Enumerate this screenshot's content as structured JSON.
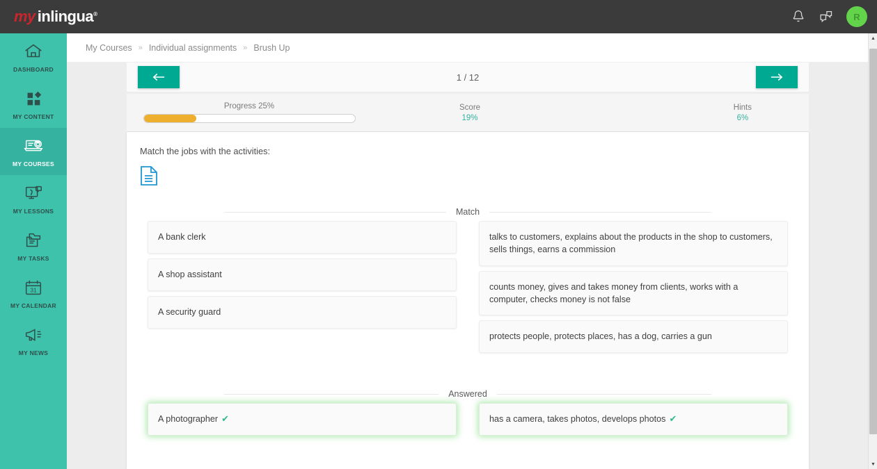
{
  "topbar": {
    "logo_my": "my",
    "logo_name": "inlingua",
    "logo_reg": "®",
    "bell_icon": "bell-icon",
    "chat_icon": "chat-bubbles-icon",
    "avatar_initial": "R",
    "avatar_color": "#62d34a",
    "background": "#3b3b3b"
  },
  "sidebar": {
    "background": "#3ec2ac",
    "active_background": "#35b2a0",
    "items": [
      {
        "label": "DASHBOARD",
        "icon": "home-icon",
        "active": false
      },
      {
        "label": "MY CONTENT",
        "icon": "blocks-icon",
        "active": false
      },
      {
        "label": "MY COURSES",
        "icon": "laptop-graduation-cap-icon",
        "active": true
      },
      {
        "label": "MY LESSONS",
        "icon": "screen-chat-icon",
        "active": false
      },
      {
        "label": "MY TASKS",
        "icon": "folder-files-icon",
        "active": false
      },
      {
        "label": "MY CALENDAR",
        "icon": "calendar-31-icon",
        "active": false
      },
      {
        "label": "MY NEWS",
        "icon": "megaphone-icon",
        "active": false
      }
    ]
  },
  "breadcrumb": {
    "separator": "»",
    "items": [
      "My Courses",
      "Individual assignments",
      "Brush Up"
    ]
  },
  "nav": {
    "prev_icon": "arrow-left-icon",
    "next_icon": "arrow-right-icon",
    "page_counter": "1 / 12",
    "button_color": "#00a991"
  },
  "progress": {
    "label": "Progress 25%",
    "percent": 25,
    "fill_color": "#efaf2e"
  },
  "stats": [
    {
      "key": "Score",
      "value": "19%"
    },
    {
      "key": "Hints",
      "value": "6%"
    }
  ],
  "exercise": {
    "instruction": "Match the jobs with the activities:",
    "document_icon": "document-icon",
    "document_icon_color": "#2196d4",
    "sections": [
      {
        "title": "Match",
        "left": [
          "A bank clerk",
          "A shop assistant",
          "A security guard"
        ],
        "right": [
          "talks to customers, explains about the products in the shop to customers, sells things, earns a commission",
          "counts money, gives and takes money from clients, works with a computer, checks money is not false",
          "protects people, protects places, has a dog, carries a gun"
        ]
      },
      {
        "title": "Answered",
        "check_mark": "✔",
        "left": [
          "A photographer"
        ],
        "right": [
          "has a camera, takes photos, develops photos"
        ]
      }
    ]
  },
  "scrollbar": {
    "up_arrow": "▲",
    "down_arrow": "▼"
  }
}
